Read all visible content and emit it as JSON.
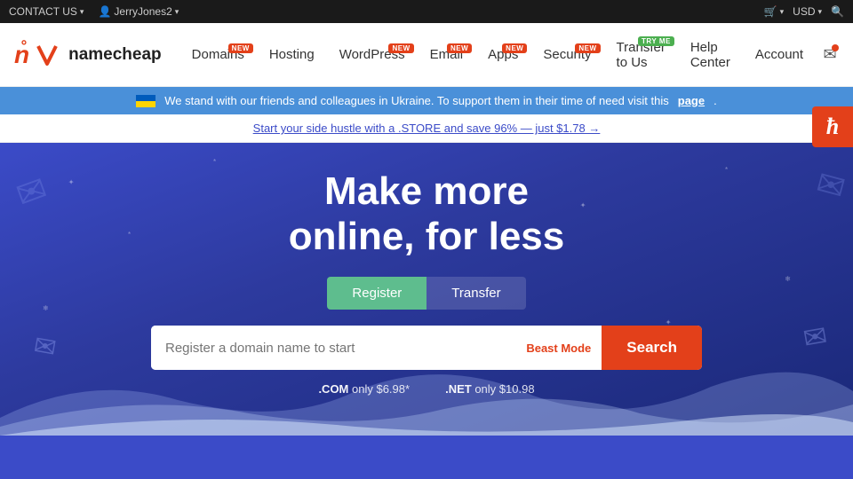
{
  "topbar": {
    "contact_label": "CONTACT US",
    "user_label": "JerryJones2",
    "cart_label": "",
    "currency_label": "USD",
    "search_icon": "🔍",
    "cart_icon": "🛒",
    "user_icon": "👤"
  },
  "nav": {
    "logo_icon": "n",
    "logo_text": "namecheap",
    "links": [
      {
        "label": "Domains",
        "badge": "NEW",
        "badge_type": "new"
      },
      {
        "label": "Hosting",
        "badge": "",
        "badge_type": ""
      },
      {
        "label": "WordPress",
        "badge": "NEW",
        "badge_type": "new"
      },
      {
        "label": "Email",
        "badge": "NEW",
        "badge_type": "new"
      },
      {
        "label": "Apps",
        "badge": "NEW",
        "badge_type": "new"
      },
      {
        "label": "Security",
        "badge": "NEW",
        "badge_type": "new"
      },
      {
        "label": "Transfer to Us",
        "badge": "TRY ME",
        "badge_type": "tryme"
      },
      {
        "label": "Help Center",
        "badge": "",
        "badge_type": ""
      },
      {
        "label": "Account",
        "badge": "",
        "badge_type": ""
      }
    ],
    "email_icon": "✉",
    "notifications_icon": "🔔"
  },
  "ukraine_banner": {
    "text": "We stand with our friends and colleagues in Ukraine. To support them in their time of need visit this",
    "link_text": "page",
    "link_url": "#"
  },
  "promo_banner": {
    "text": "Start your side hustle with a .STORE and save 96% — just $1.78 →",
    "link_url": "#"
  },
  "hero": {
    "title_line1": "Make more",
    "title_line2": "online, for less",
    "tab_register": "Register",
    "tab_transfer": "Transfer",
    "search_placeholder": "Register a domain name to start",
    "beast_mode_label": "Beast Mode",
    "search_button_label": "Search",
    "domain_hint1_tld": ".COM",
    "domain_hint1_price": "only $6.98*",
    "domain_hint2_tld": ".NET",
    "domain_hint2_price": "only $10.98"
  },
  "haptic": {
    "icon": "h"
  }
}
